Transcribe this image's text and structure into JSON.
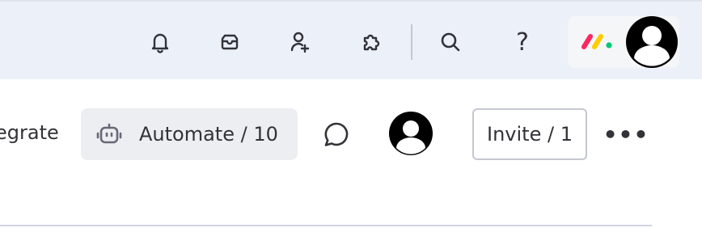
{
  "topbar": {
    "icons": [
      {
        "name": "bell-icon",
        "label": "Notifications"
      },
      {
        "name": "inbox-icon",
        "label": "Inbox"
      },
      {
        "name": "invite-members-icon",
        "label": "Invite members"
      },
      {
        "name": "apps-icon",
        "label": "Marketplace"
      },
      {
        "name": "search-icon",
        "label": "Search"
      },
      {
        "name": "help-icon",
        "label": "Help"
      }
    ],
    "help_glyph": "?",
    "logo_colors": [
      "#fb275d",
      "#ffcc00",
      "#00ca72"
    ]
  },
  "board_header": {
    "integrate_label": "egrate",
    "automate_label": "Automate / 10",
    "invite_label": "Invite / 1",
    "more_label": "•••"
  },
  "colors": {
    "topbar_bg": "#ecf0f9",
    "button_bg": "#eceef1",
    "text": "#323338",
    "border": "#c5c7d0"
  }
}
